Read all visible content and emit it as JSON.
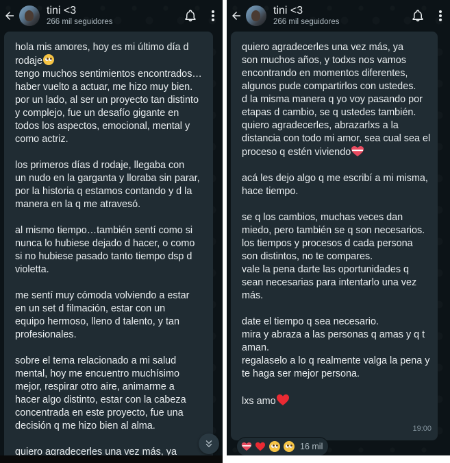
{
  "channel": {
    "name": "tini <3",
    "followers": "266 mil seguidores"
  },
  "left_panel": {
    "message_text": "hola mis amores, hoy es mi último día d\nrodaje",
    "message_text_2": "tengo muchos sentimientos encontrados…\nhaber vuelto a actuar, me hizo muy bien.\npor un lado, al ser un proyecto tan distinto\ny complejo, fue un desafío gigante en\ntodos los aspectos, emocional, mental y\ncomo actriz.\n\nlos primeros días d rodaje, llegaba con\nun nudo en la garganta y lloraba sin parar,\npor la historia q estamos contando y d la\nmanera en la q me atravesó.\n\nal mismo tiempo…también sentí como si\nnunca lo hubiese dejado d hacer, o como\nsi no hubiese pasado tanto tiempo dsp d\nvioletta.\n\nme sentí muy cómoda volviendo a estar\nen un set d filmación, estar con un\nequipo hermoso, lleno d talento, y tan\nprofesionales.\n\nsobre el tema relacionado a mi salud\nmental, hoy me encuentro muchísimo\nmejor, respirar otro aire, animarme a\nhacer algo distinto, estar con la cabeza\nconcentrada en este proyecto, fue una\ndecisión q me hizo bien al alma.\n\nquiero agradecerles una vez más, ya\nson muchos años, y todxs nos vamos\nencontrando en momentos diferentes,"
  },
  "right_panel": {
    "message_text": "quiero agradecerles una vez más, ya\nson muchos años, y todxs nos vamos\nencontrando en momentos diferentes,\nalgunos pude compartirlos con ustedes.\nd la misma manera q yo voy pasando por\netapas d cambio, se q ustedes también.\nquiero agradecerles, abrazarlxs a la\ndistancia con todo mi amor, sea cual sea el\nproceso q estén viviendo",
    "message_text_2": "\n\nacá les dejo algo q me escribí a mi misma,\nhace tiempo.\n\nse q los cambios, muchas veces dan\nmiedo, pero también se q son necesarios.\nlos tiempos y procesos d cada persona\nson distintos, no te compares.\nvale la pena darte las oportunidades q\nsean necesarias para intentarlo una vez\nmás.\n\ndate el tiempo q sea necesario.\nmira y abraza a las personas q amas y q t\naman.\nregalaselo a lo q realmente valga la pena y\nte haga ser mejor persona.\n\nlxs amo",
    "time": "19:00",
    "reaction_count": "16 mil"
  },
  "icons": {
    "back": "arrow-left-icon",
    "bell": "bell-icon",
    "menu": "more-vertical-icon",
    "scroll": "double-chevron-down-icon"
  },
  "colors": {
    "background": "#0c1317",
    "bubble": "#202c33",
    "text": "#e9edef",
    "muted": "#8696a0"
  }
}
